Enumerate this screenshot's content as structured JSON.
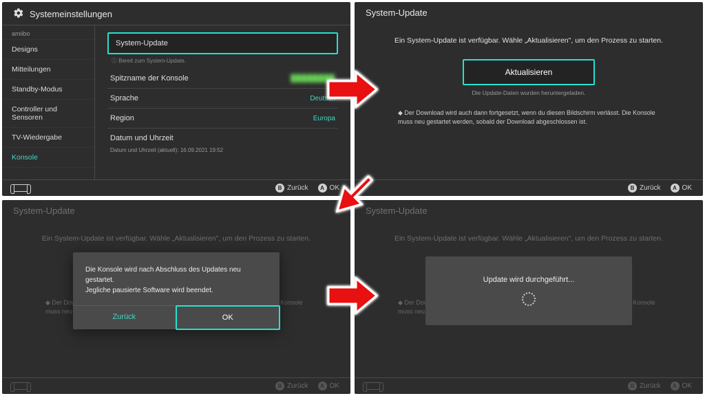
{
  "panel1": {
    "title": "Systemeinstellungen",
    "sidebar": {
      "top": "amiibo",
      "items": [
        "Designs",
        "Mitteilungen",
        "Standby-Modus",
        "Controller und Sensoren",
        "TV-Wiedergabe",
        "Konsole"
      ]
    },
    "rows": {
      "system_update": "System-Update",
      "system_update_sub": "Bereit zum System-Update.",
      "nickname": "Spitzname der Konsole",
      "nickname_value": "████████",
      "language": "Sprache",
      "language_value": "Deutsch",
      "region": "Region",
      "region_value": "Europa",
      "datetime": "Datum und Uhrzeit",
      "datetime_sub": "Datum und Uhrzeit (aktuell): 16.09.2021 19:52"
    }
  },
  "panel2": {
    "title": "System-Update",
    "msg": "Ein System-Update ist verfügbar. Wähle „Aktualisieren\", um den Prozess zu starten.",
    "button": "Aktualisieren",
    "downloaded": "Die Update-Daten wurden heruntergeladen.",
    "note": "Der Download wird auch dann fortgesetzt, wenn du diesen Bildschirm verlässt. Die Konsole muss neu gestartet werden, sobald der Download abgeschlossen ist."
  },
  "panel3": {
    "modal_line1": "Die Konsole wird nach Abschluss des Updates neu gestartet.",
    "modal_line2": "Jegliche pausierte Software wird beendet.",
    "back": "Zurück",
    "ok": "OK"
  },
  "panel4": {
    "progress": "Update wird durchgeführt..."
  },
  "footer": {
    "back": "Zurück",
    "ok": "OK"
  }
}
